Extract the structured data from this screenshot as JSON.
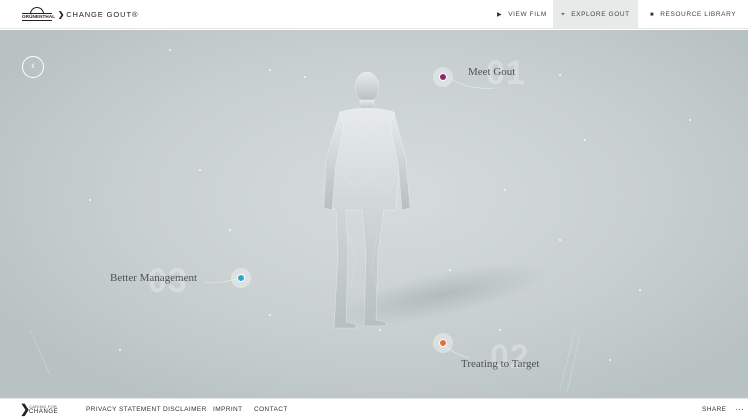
{
  "header": {
    "logo_company": "GRÜNENTHAL",
    "logo_brand": "CHANGE GOUT",
    "nav": [
      {
        "label": "VIEW FILM",
        "icon": "play-icon"
      },
      {
        "label": "EXPLORE GOUT",
        "icon": "explore-icon",
        "active": true
      },
      {
        "label": "RESOURCE LIBRARY",
        "icon": "folder-icon"
      }
    ]
  },
  "scene": {
    "back_icon": "‹",
    "hotspots": [
      {
        "label": "Meet Gout",
        "number": "01",
        "color": "#8a2a6e"
      },
      {
        "label": "Treating to Target",
        "number": "02",
        "color": "#e0703e"
      },
      {
        "label": "Better Management",
        "number": "03",
        "color": "#2aa6c8"
      }
    ]
  },
  "footer": {
    "logo_line1": "CARING FOR",
    "logo_line2": "CHANGE",
    "links": [
      "PRIVACY STATEMENT",
      "DISCLAIMER",
      "IMPRINT",
      "CONTACT"
    ],
    "share": "SHARE",
    "more": "···"
  }
}
